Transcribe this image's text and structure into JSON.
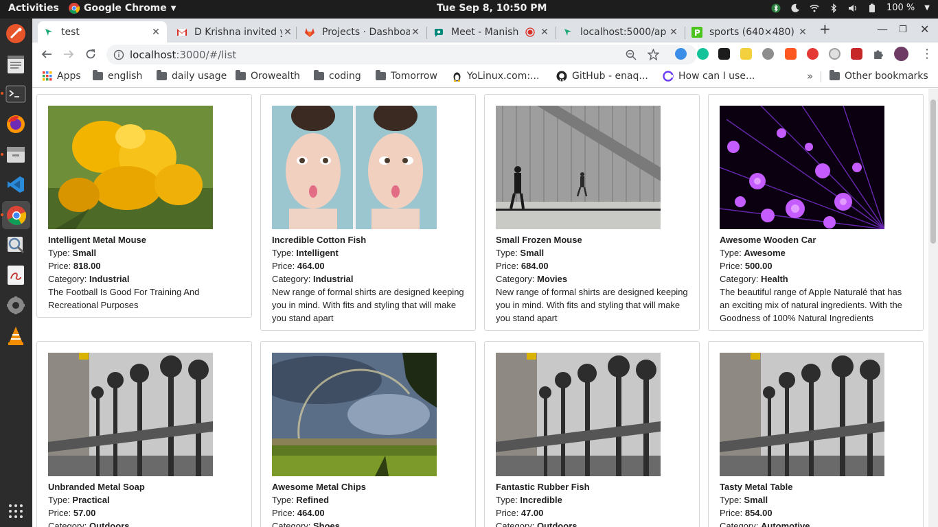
{
  "system": {
    "activities": "Activities",
    "app_name": "Google Chrome",
    "clock": "Tue Sep  8, 10:50 PM",
    "battery": "100 %"
  },
  "tabs": [
    {
      "title": "test",
      "active": true
    },
    {
      "title": "D Krishna invited y"
    },
    {
      "title": "Projects · Dashboa"
    },
    {
      "title": "Meet - Manish"
    },
    {
      "title": "localhost:5000/ap"
    },
    {
      "title": "sports (640×480)"
    }
  ],
  "toolbar": {
    "url_host": "localhost",
    "url_rest": ":3000/#/list"
  },
  "bookmarks": [
    {
      "label": "Apps",
      "icon": "apps-grid-icon"
    },
    {
      "label": "english",
      "icon": "folder-icon"
    },
    {
      "label": "daily usage",
      "icon": "folder-icon"
    },
    {
      "label": "Orowealth",
      "icon": "folder-icon"
    },
    {
      "label": "coding",
      "icon": "folder-icon"
    },
    {
      "label": "Tomorrow",
      "icon": "folder-icon"
    },
    {
      "label": "YoLinux.com:...",
      "icon": "tux-icon"
    },
    {
      "label": "GitHub - enaq...",
      "icon": "github-icon"
    },
    {
      "label": "How can I use...",
      "icon": "help-icon"
    }
  ],
  "other_bookmarks": "Other bookmarks",
  "labels": {
    "type": "Type: ",
    "price": "Price: ",
    "category": "Category: "
  },
  "products": [
    {
      "name": "Intelligent Metal Mouse",
      "type": "Small",
      "price": "818.00",
      "category": "Industrial",
      "description": "The Football Is Good For Training And Recreational Purposes",
      "image": "yellow-flower"
    },
    {
      "name": "Incredible Cotton Fish",
      "type": "Intelligent",
      "price": "464.00",
      "category": "Industrial",
      "description": "New range of formal shirts are designed keeping you in mind. With fits and styling that will make you stand apart",
      "image": "woman-faces"
    },
    {
      "name": "Small Frozen Mouse",
      "type": "Small",
      "price": "684.00",
      "category": "Movies",
      "description": "New range of formal shirts are designed keeping you in mind. With fits and styling that will make you stand apart",
      "image": "street-walkers"
    },
    {
      "name": "Awesome Wooden Car",
      "type": "Awesome",
      "price": "500.00",
      "category": "Health",
      "description": "The beautiful range of Apple Naturalé that has an exciting mix of natural ingredients. With the Goodness of 100% Natural Ingredients",
      "image": "purple-fiber-optics"
    },
    {
      "name": "Unbranded Metal Soap",
      "type": "Practical",
      "price": "57.00",
      "category": "Outdoors",
      "description": "",
      "image": "bridge-lamps"
    },
    {
      "name": "Awesome Metal Chips",
      "type": "Refined",
      "price": "464.00",
      "category": "Shoes",
      "description": "",
      "image": "rainbow-field"
    },
    {
      "name": "Fantastic Rubber Fish",
      "type": "Incredible",
      "price": "47.00",
      "category": "Outdoors",
      "description": "",
      "image": "bridge-lamps"
    },
    {
      "name": "Tasty Metal Table",
      "type": "Small",
      "price": "854.00",
      "category": "Automotive",
      "description": "",
      "image": "bridge-lamps"
    }
  ]
}
